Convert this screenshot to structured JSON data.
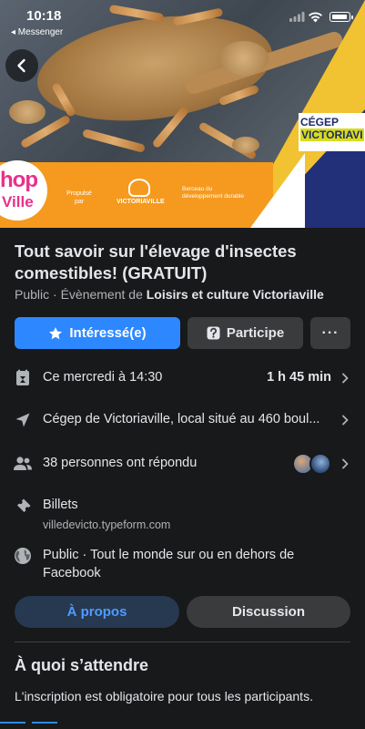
{
  "status_bar": {
    "time": "10:18",
    "back_app": "◂ Messenger"
  },
  "cover": {
    "logo_hop": "hop",
    "logo_ville": "Ville",
    "propulse": "Propulsé par",
    "victoriaville": "VICTORIAVILLE",
    "berceau": "Berceau du développement durable",
    "cegep_line1": "CÉGEP",
    "cegep_line2": "VICTORIAVI"
  },
  "event": {
    "title": "Tout savoir sur l'élevage d'insectes comestibles! (GRATUIT)",
    "visibility_prefix": "Public · Évènement de ",
    "organizer": "Loisirs et culture Victoriaville"
  },
  "actions": {
    "interested": "Intéressé(e)",
    "going": "Participe",
    "more": "···"
  },
  "details": {
    "date": "Ce mercredi à 14:30",
    "duration": "1 h 45 min",
    "location": "Cégep de Victoriaville, local situé au 460 boul...",
    "responses": "38 personnes ont répondu",
    "tickets_label": "Billets",
    "tickets_url": "villedevicto.typeform.com",
    "privacy_line1": "Public · Tout le monde sur ou en dehors de",
    "privacy_line2": "Facebook"
  },
  "tabs": {
    "about": "À propos",
    "discussion": "Discussion"
  },
  "about": {
    "heading": "À quoi s’attendre",
    "text": "L'inscription est obligatoire pour tous les participants."
  },
  "colors": {
    "accent": "#2d88ff",
    "background": "#18191a",
    "button_secondary": "#3a3b3c"
  }
}
